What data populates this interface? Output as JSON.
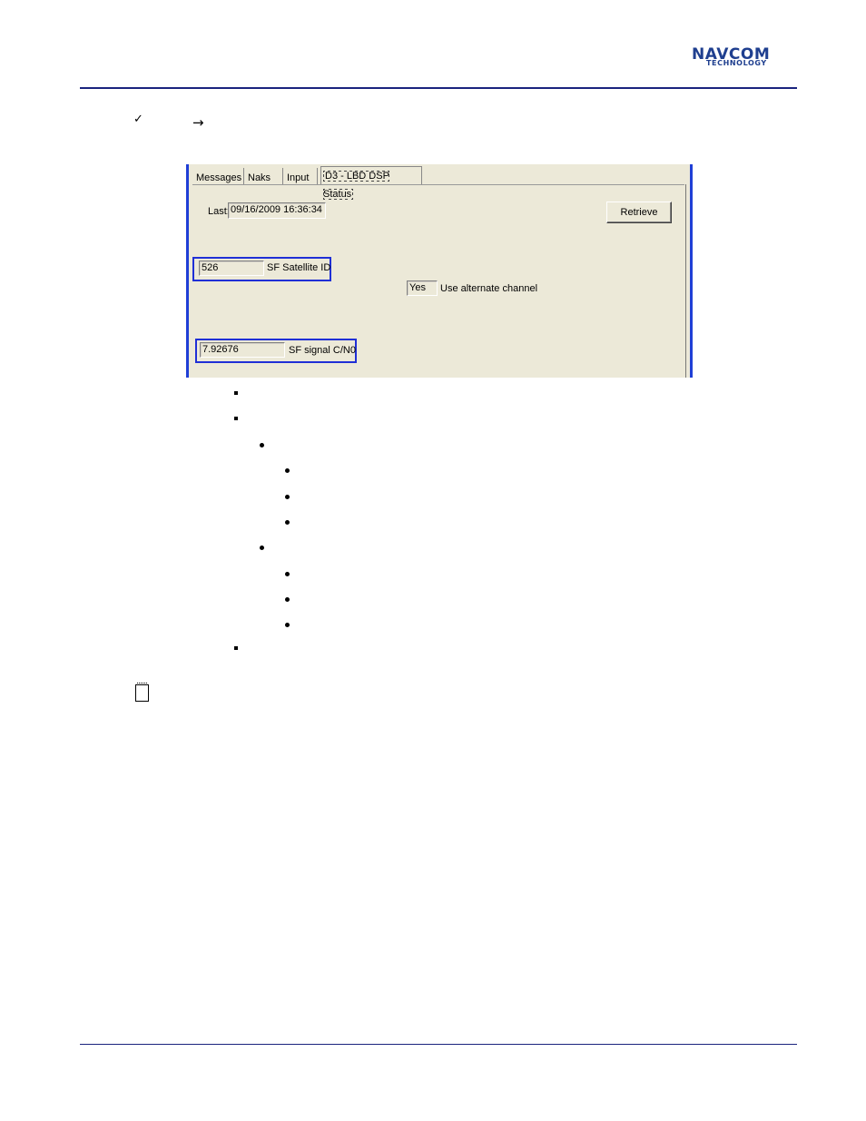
{
  "header": {
    "logo_primary": "NAVCOM",
    "logo_secondary": "TECHNOLOGY"
  },
  "glyphs": {
    "check": "✓",
    "arrow": "→"
  },
  "screenshot": {
    "tabs": [
      "Messages",
      "Naks",
      "Input",
      "D3 - LBD DSP Status"
    ],
    "active_tab": "D3 - LBD DSP Status",
    "last_label": "Last:",
    "last_value": "09/16/2009 16:36:34",
    "retrieve_button": "Retrieve",
    "sf_satellite_id_value": "526",
    "sf_satellite_id_label": "SF Satellite ID",
    "alternate_channel_value": "Yes",
    "alternate_channel_label": "Use alternate channel",
    "sf_signal_cn0_value": "7.92676",
    "sf_signal_cn0_label": "SF signal C/N0"
  }
}
